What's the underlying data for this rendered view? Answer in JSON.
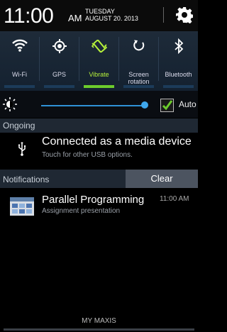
{
  "status_bar": {
    "time": "11:00",
    "ampm": "AM",
    "day": "TUESDAY",
    "date": "AUGUST 20. 2013"
  },
  "quick_settings": [
    {
      "label": "Wi-Fi",
      "icon": "wifi-icon",
      "active": false
    },
    {
      "label": "GPS",
      "icon": "gps-icon",
      "active": false
    },
    {
      "label": "Vibrate",
      "icon": "vibrate-icon",
      "active": true
    },
    {
      "label": "Screen rotation",
      "icon": "screen-rotation-icon",
      "active": false
    },
    {
      "label": "Bluetooth",
      "icon": "bluetooth-icon",
      "active": false
    }
  ],
  "brightness": {
    "auto_label": "Auto",
    "auto_checked": true,
    "level": 0.98
  },
  "ongoing": {
    "header": "Ongoing",
    "title": "Connected as a media device",
    "subtitle": "Touch for other USB options."
  },
  "notifications": {
    "header": "Notifications",
    "clear_label": "Clear",
    "items": [
      {
        "title": "Parallel Programming",
        "time": "11:00 AM",
        "subtitle": "Assignment presentation"
      }
    ]
  },
  "carrier": "MY MAXIS",
  "colors": {
    "accent_green": "#b7f23b",
    "slider_blue": "#2f91d6"
  }
}
